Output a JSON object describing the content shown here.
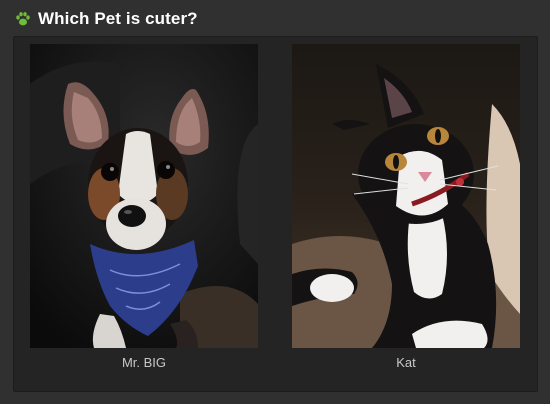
{
  "header": {
    "icon": "paw-icon",
    "title": "Which Pet is cuter?",
    "icon_color": "#6fbe3a"
  },
  "candidates": [
    {
      "name": "Mr. BIG",
      "photo": "dog-photo"
    },
    {
      "name": "Kat",
      "photo": "cat-photo"
    }
  ]
}
